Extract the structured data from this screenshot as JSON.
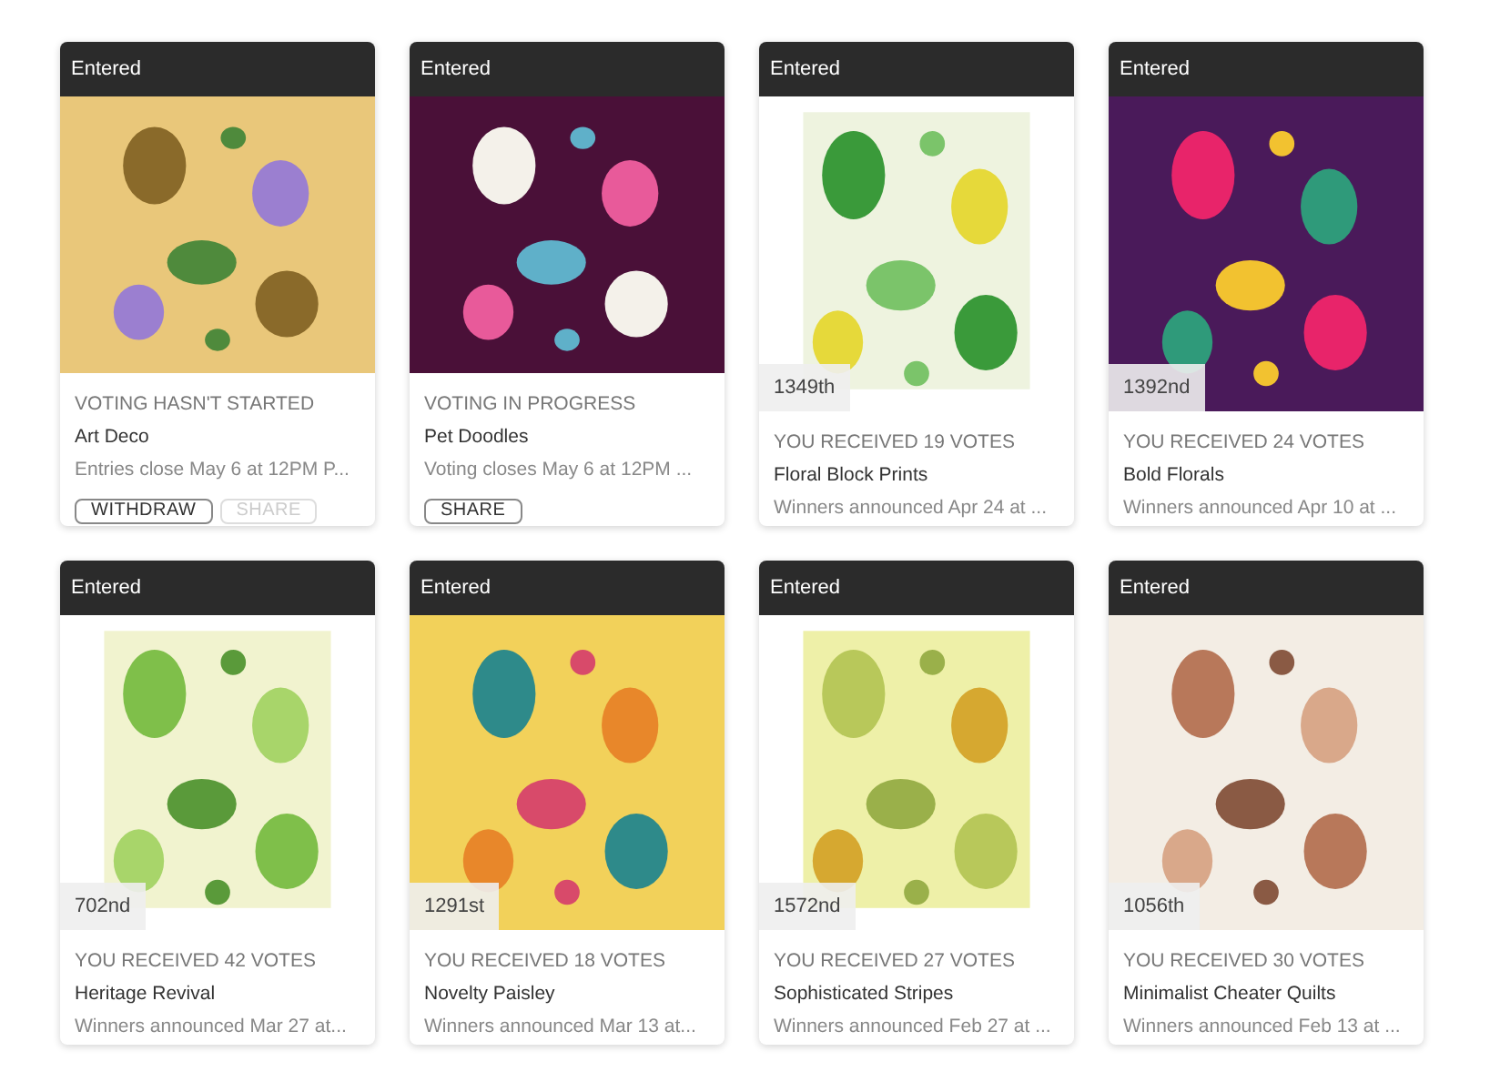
{
  "cards": [
    {
      "badge": "Entered",
      "status": "VOTING HASN'T STARTED",
      "title": "Art Deco",
      "subtitle": "Entries close May 6 at 12PM P...",
      "buttons": [
        {
          "label": "WITHDRAW",
          "disabled": false
        },
        {
          "label": "SHARE",
          "disabled": true
        }
      ]
    },
    {
      "badge": "Entered",
      "status": "VOTING IN PROGRESS",
      "title": "Pet Doodles",
      "subtitle": "Voting closes May 6 at 12PM ...",
      "buttons": [
        {
          "label": "SHARE",
          "disabled": false
        }
      ]
    },
    {
      "badge": "Entered",
      "rank": "1349th",
      "status": "YOU RECEIVED 19 VOTES",
      "title": "Floral Block Prints",
      "subtitle": "Winners announced Apr 24 at ..."
    },
    {
      "badge": "Entered",
      "rank": "1392nd",
      "status": "YOU RECEIVED 24 VOTES",
      "title": "Bold Florals",
      "subtitle": "Winners announced Apr 10 at ..."
    },
    {
      "badge": "Entered",
      "rank": "702nd",
      "status": "YOU RECEIVED 42 VOTES",
      "title": "Heritage Revival",
      "subtitle": "Winners announced Mar 27 at..."
    },
    {
      "badge": "Entered",
      "rank": "1291st",
      "status": "YOU RECEIVED 18 VOTES",
      "title": "Novelty Paisley",
      "subtitle": "Winners announced Mar 13 at..."
    },
    {
      "badge": "Entered",
      "rank": "1572nd",
      "status": "YOU RECEIVED 27 VOTES",
      "title": "Sophisticated Stripes",
      "subtitle": "Winners announced Feb 27 at ..."
    },
    {
      "badge": "Entered",
      "rank": "1056th",
      "status": "YOU RECEIVED 30 VOTES",
      "title": "Minimalist Cheater Quilts",
      "subtitle": "Winners announced Feb 13 at ..."
    }
  ]
}
